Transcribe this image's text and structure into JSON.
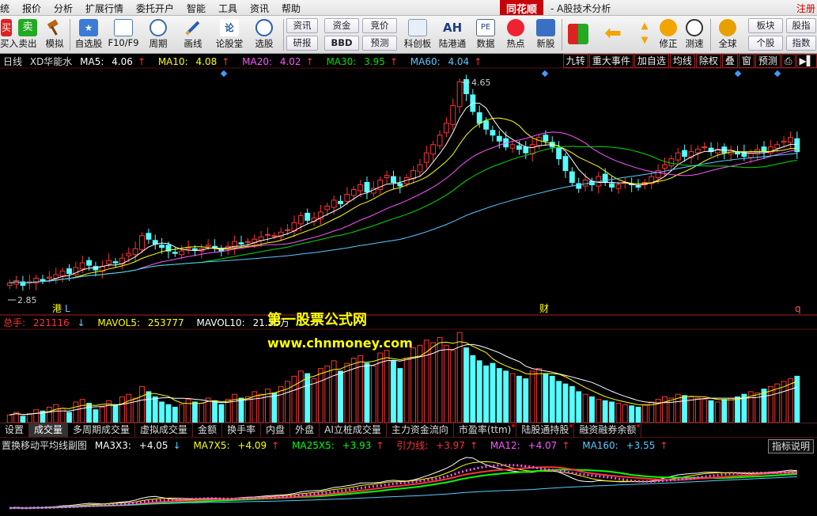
{
  "menu": {
    "items": [
      "统",
      "报价",
      "分析",
      "扩展行情",
      "委托开户",
      "智能",
      "工具",
      "资讯",
      "帮助"
    ],
    "logo": "同花顺",
    "app_title": "- A股技术分析",
    "login": "注册"
  },
  "toolbar": {
    "buttons": [
      "买入",
      "卖出",
      "模拟",
      "自选股",
      "F10/F9",
      "周期",
      "画线",
      "论股堂",
      "选股"
    ],
    "small_left": [
      [
        "资讯",
        "研报"
      ],
      [
        "资金",
        "BBD"
      ],
      [
        "竞价",
        "预测"
      ]
    ],
    "buttons2": [
      "科创板",
      "陆港通",
      "数据",
      "热点",
      "新股"
    ],
    "buttons3": [
      "修正",
      "测速"
    ],
    "buttons4": [
      "全球"
    ],
    "small_right": [
      [
        "板块",
        "个股"
      ],
      [
        "股指",
        "指数"
      ]
    ],
    "icons": [
      "buy-icon",
      "sell-icon",
      "gavel-icon",
      "star-icon",
      "f10-icon",
      "clock-icon",
      "pencil-icon",
      "forum-icon",
      "search-icon"
    ]
  },
  "kline": {
    "period": "日线",
    "stock": "XD华能水",
    "ma": [
      {
        "label": "MA5:",
        "value": "4.06",
        "color": "#ffffff"
      },
      {
        "label": "MA10:",
        "value": "4.08",
        "color": "#ffff00"
      },
      {
        "label": "MA20:",
        "value": "4.02",
        "color": "#ff55ff"
      },
      {
        "label": "MA30:",
        "value": "3.95",
        "color": "#00dd00"
      },
      {
        "label": "MA60:",
        "value": "4.04",
        "color": "#55ccff"
      }
    ],
    "arrow": "↑",
    "right_tabs": [
      "九转",
      "重大事件",
      "加自选",
      "均线",
      "除权",
      "叠",
      "窗",
      "预测",
      "⎙",
      "▶▌"
    ],
    "high_label": "4.65",
    "low_label": "2.85",
    "markers": {
      "gang": "港",
      "l": "L",
      "cai": "财",
      "q": "q"
    }
  },
  "volume": {
    "label": "总手:",
    "value": "221116",
    "down_arrow": "↓",
    "mavol5_label": "MAVOL5:",
    "mavol5_value": "253777",
    "mavol10_label": "MAVOL10:",
    "mavol10_value": "21.30万"
  },
  "indicator_tabs": [
    "设置",
    "成交量",
    "多周期成交量",
    "虚拟成交量",
    "金额",
    "换手率",
    "内盘",
    "外盘",
    "AI立桩成交量",
    "主力资金流向",
    "市盈率(ttm)",
    "陆股通持股",
    "融资融券余额"
  ],
  "sub_indicator": {
    "name": "置换移动平均线副图",
    "items": [
      {
        "label": "MA3X3:",
        "value": "+4.05",
        "arrow": "↓",
        "color": "#ffffff"
      },
      {
        "label": "MA7X5:",
        "value": "+4.09",
        "arrow": "↑",
        "color": "#ffff00"
      },
      {
        "label": "MA25X5:",
        "value": "+3.93",
        "arrow": "↑",
        "color": "#00ff00"
      },
      {
        "label": "引力线:",
        "value": "+3.97",
        "arrow": "↑",
        "color": "#ff3333"
      },
      {
        "label": "MA12:",
        "value": "+4.07",
        "arrow": "↑",
        "color": "#ff55ff"
      },
      {
        "label": "MA160:",
        "value": "+3.55",
        "arrow": "↑",
        "color": "#55ccff"
      }
    ],
    "help": "指标说明"
  },
  "watermark": {
    "line1": "第一股票公式网",
    "line2": "www.chnmoney.com"
  },
  "colors": {
    "up": "#ff3333",
    "down": "#55ffff",
    "bg": "#000000"
  },
  "chart_data": {
    "type": "candlestick",
    "price_range": [
      2.85,
      4.65
    ],
    "closes": [
      2.95,
      2.97,
      2.93,
      2.96,
      2.99,
      2.97,
      3.0,
      3.02,
      3.05,
      3.03,
      3.08,
      3.12,
      3.1,
      3.06,
      3.09,
      3.14,
      3.12,
      3.16,
      3.2,
      3.24,
      3.35,
      3.32,
      3.28,
      3.25,
      3.22,
      3.2,
      3.22,
      3.25,
      3.23,
      3.24,
      3.27,
      3.25,
      3.22,
      3.26,
      3.3,
      3.28,
      3.3,
      3.32,
      3.34,
      3.36,
      3.35,
      3.38,
      3.4,
      3.46,
      3.52,
      3.48,
      3.5,
      3.55,
      3.6,
      3.65,
      3.62,
      3.7,
      3.74,
      3.78,
      3.72,
      3.75,
      3.82,
      3.86,
      3.8,
      3.77,
      3.84,
      3.9,
      3.95,
      4.05,
      4.12,
      4.2,
      4.3,
      4.45,
      4.65,
      4.55,
      4.4,
      4.3,
      4.25,
      4.2,
      4.15,
      4.1,
      4.12,
      4.08,
      4.05,
      4.12,
      4.18,
      4.15,
      4.1,
      4.0,
      3.9,
      3.8,
      3.75,
      3.82,
      3.78,
      3.85,
      3.8,
      3.76,
      3.78,
      3.8,
      3.78,
      3.76,
      3.8,
      3.85,
      3.9,
      3.95,
      4.0,
      4.05,
      4.02,
      4.06,
      4.08,
      4.1,
      4.06,
      4.08,
      4.05,
      4.07,
      4.04,
      4.02,
      4.05,
      4.08,
      4.06,
      4.1,
      4.12,
      4.15,
      4.18,
      4.06
    ],
    "volumes": [
      30,
      40,
      25,
      35,
      50,
      45,
      60,
      70,
      55,
      40,
      80,
      90,
      75,
      50,
      60,
      85,
      70,
      100,
      110,
      95,
      140,
      120,
      100,
      80,
      70,
      60,
      70,
      90,
      80,
      75,
      95,
      85,
      70,
      90,
      110,
      95,
      100,
      120,
      110,
      130,
      115,
      140,
      160,
      180,
      200,
      190,
      170,
      210,
      220,
      240,
      200,
      230,
      250,
      260,
      230,
      220,
      270,
      280,
      240,
      210,
      250,
      290,
      300,
      320,
      310,
      330,
      300,
      280,
      350,
      290,
      260,
      240,
      220,
      230,
      210,
      200,
      190,
      180,
      170,
      200,
      210,
      190,
      180,
      160,
      150,
      140,
      120,
      110,
      100,
      90,
      85,
      80,
      75,
      70,
      65,
      60,
      70,
      80,
      90,
      100,
      95,
      110,
      105,
      100,
      95,
      90,
      85,
      80,
      90,
      95,
      100,
      110,
      120,
      115,
      130,
      140,
      150,
      160,
      170,
      180
    ]
  }
}
